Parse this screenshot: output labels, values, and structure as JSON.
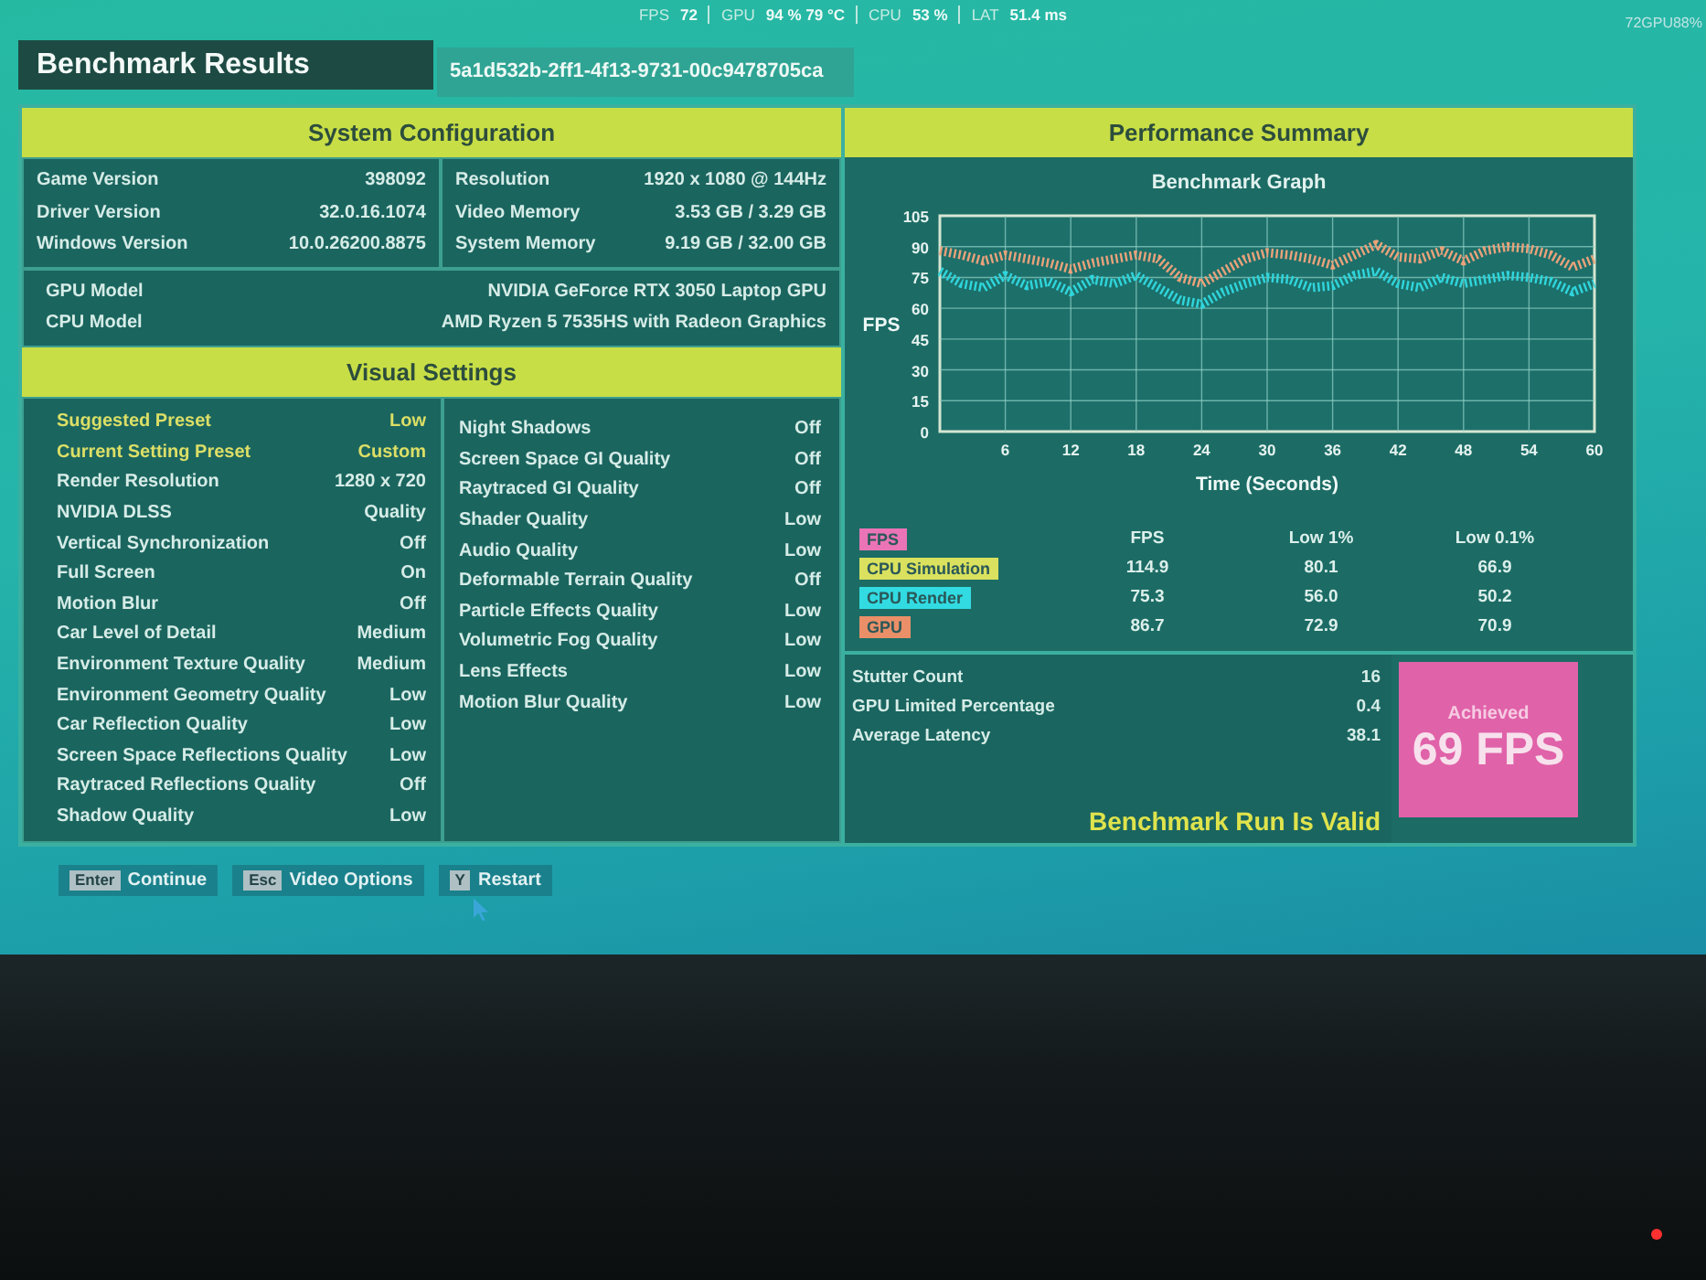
{
  "overlay": {
    "stats": [
      {
        "label": "FPS",
        "value": "72"
      },
      {
        "label": "GPU",
        "value": "94 % 79 °C"
      },
      {
        "label": "CPU",
        "value": "53 %"
      },
      {
        "label": "LAT",
        "value": "51.4 ms"
      }
    ],
    "corner_text": "72GPU88%"
  },
  "header": {
    "title": "Benchmark Results",
    "run_id": "5a1d532b-2ff1-4f13-9731-00c9478705ca"
  },
  "system_configuration": {
    "title": "System Configuration",
    "left": [
      {
        "label": "Game Version",
        "value": "398092"
      },
      {
        "label": "Driver Version",
        "value": "32.0.16.1074"
      },
      {
        "label": "Windows Version",
        "value": "10.0.26200.8875"
      }
    ],
    "right": [
      {
        "label": "Resolution",
        "value": "1920 x 1080 @ 144Hz"
      },
      {
        "label": "Video Memory",
        "value": "3.53 GB / 3.29 GB"
      },
      {
        "label": "System Memory",
        "value": "9.19 GB / 32.00 GB"
      }
    ],
    "hardware": [
      {
        "label": "GPU Model",
        "value": "NVIDIA GeForce RTX 3050 Laptop GPU"
      },
      {
        "label": "CPU Model",
        "value": "AMD Ryzen 5 7535HS with Radeon Graphics"
      }
    ]
  },
  "visual_settings": {
    "title": "Visual Settings",
    "left": [
      {
        "label": "Suggested Preset",
        "value": "Low",
        "highlighted": true
      },
      {
        "label": "Current Setting Preset",
        "value": "Custom",
        "highlighted": true
      },
      {
        "label": "Render Resolution",
        "value": "1280 x 720",
        "highlighted": false
      },
      {
        "label": "NVIDIA DLSS",
        "value": "Quality",
        "highlighted": false
      },
      {
        "label": "Vertical Synchronization",
        "value": "Off",
        "highlighted": false
      },
      {
        "label": "Full Screen",
        "value": "On",
        "highlighted": false
      },
      {
        "label": "Motion Blur",
        "value": "Off",
        "highlighted": false
      },
      {
        "label": "Car Level of Detail",
        "value": "Medium",
        "highlighted": false
      },
      {
        "label": "Environment Texture Quality",
        "value": "Medium",
        "highlighted": false
      },
      {
        "label": "Environment Geometry Quality",
        "value": "Low",
        "highlighted": false
      },
      {
        "label": "Car Reflection Quality",
        "value": "Low",
        "highlighted": false
      },
      {
        "label": "Screen Space Reflections Quality",
        "value": "Low",
        "highlighted": false
      },
      {
        "label": "Raytraced Reflections Quality",
        "value": "Off",
        "highlighted": false
      },
      {
        "label": "Shadow Quality",
        "value": "Low",
        "highlighted": false
      }
    ],
    "right": [
      {
        "label": "Night Shadows",
        "value": "Off",
        "highlighted": false
      },
      {
        "label": "Screen Space GI Quality",
        "value": "Off",
        "highlighted": false
      },
      {
        "label": "Raytraced GI Quality",
        "value": "Off",
        "highlighted": false
      },
      {
        "label": "Shader Quality",
        "value": "Low",
        "highlighted": false
      },
      {
        "label": "Audio Quality",
        "value": "Low",
        "highlighted": false
      },
      {
        "label": "Deformable Terrain Quality",
        "value": "Off",
        "highlighted": false
      },
      {
        "label": "Particle Effects Quality",
        "value": "Low",
        "highlighted": false
      },
      {
        "label": "Volumetric Fog Quality",
        "value": "Low",
        "highlighted": false
      },
      {
        "label": "Lens Effects",
        "value": "Low",
        "highlighted": false
      },
      {
        "label": "Motion Blur Quality",
        "value": "Low",
        "highlighted": false
      }
    ]
  },
  "performance_summary": {
    "title": "Performance Summary",
    "chart": {
      "chart_data": {
        "type": "line",
        "title": "Benchmark Graph",
        "xlabel": "Time (Seconds)",
        "ylabel": "FPS",
        "grid": true,
        "x": [
          0,
          2,
          4,
          6,
          8,
          10,
          12,
          14,
          16,
          18,
          20,
          22,
          24,
          26,
          28,
          30,
          32,
          34,
          36,
          38,
          40,
          42,
          44,
          46,
          48,
          50,
          52,
          54,
          56,
          58,
          60
        ],
        "series": [
          {
            "color": "#2fd6dc",
            "line_style": "dotted",
            "values": [
              78,
              72,
              70,
              76,
              71,
              73,
              68,
              74,
              72,
              76,
              70,
              64,
              62,
              68,
              72,
              75,
              74,
              70,
              71,
              76,
              78,
              72,
              70,
              75,
              72,
              74,
              76,
              75,
              73,
              68,
              72
            ]
          },
          {
            "color": "#e9a27a",
            "line_style": "dotted",
            "values": [
              88,
              86,
              83,
              86,
              84,
              82,
              79,
              82,
              84,
              86,
              84,
              75,
              72,
              78,
              84,
              87,
              86,
              84,
              81,
              86,
              91,
              85,
              84,
              88,
              83,
              88,
              90,
              89,
              86,
              80,
              84
            ]
          }
        ],
        "xlim": [
          0,
          60
        ],
        "ylim": [
          0,
          105
        ],
        "xticks": [
          6,
          12,
          18,
          24,
          30,
          36,
          42,
          48,
          54,
          60
        ],
        "yticks": [
          0,
          15,
          30,
          45,
          60,
          75,
          90,
          105
        ]
      }
    },
    "table": {
      "columns": [
        "FPS",
        "Low 1%",
        "Low 0.1%"
      ],
      "rows": [
        {
          "label": "FPS",
          "color": "#ea74b6"
        },
        {
          "label": "CPU Simulation",
          "color": "#d9e15e",
          "values": [
            "114.9",
            "80.1",
            "66.9"
          ]
        },
        {
          "label": "CPU Render",
          "color": "#32dbe2",
          "values": [
            "75.3",
            "56.0",
            "50.2"
          ]
        },
        {
          "label": "GPU",
          "color": "#ea8f68",
          "values": [
            "86.7",
            "72.9",
            "70.9"
          ]
        }
      ]
    },
    "stats": [
      {
        "label": "Stutter Count",
        "value": "16"
      },
      {
        "label": "GPU Limited Percentage",
        "value": "0.4"
      },
      {
        "label": "Average Latency",
        "value": "38.1"
      }
    ],
    "validity": "Benchmark Run Is Valid",
    "achieved": {
      "label": "Achieved",
      "value": "69 FPS"
    }
  },
  "actions": [
    {
      "key": "Enter",
      "label": "Continue"
    },
    {
      "key": "Esc",
      "label": "Video Options"
    },
    {
      "key": "Y",
      "label": "Restart"
    }
  ]
}
